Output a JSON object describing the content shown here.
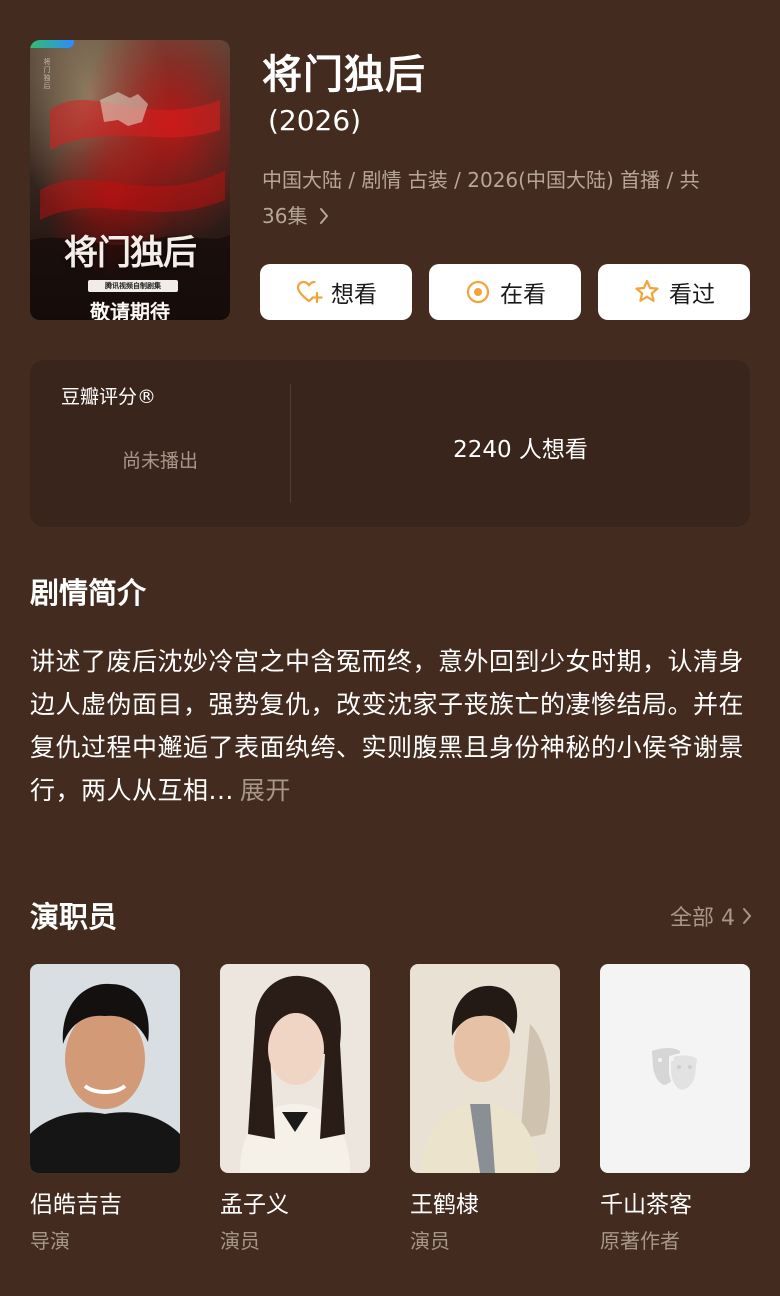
{
  "show": {
    "title": "将门独后",
    "year": "(2026)",
    "meta_line1": "中国大陆 / 剧情 古装 / 2026(中国大陆) 首播 / 共",
    "meta_line2": "36集"
  },
  "poster": {
    "title": "将门独后",
    "badge": "腾讯视频自制剧集",
    "tagline": "敬请期待"
  },
  "actions": [
    {
      "label": "想看",
      "icon": "heart-plus-icon"
    },
    {
      "label": "在看",
      "icon": "target-circle-icon"
    },
    {
      "label": "看过",
      "icon": "star-outline-icon"
    }
  ],
  "rating": {
    "label": "豆瓣评分®",
    "status": "尚未播出",
    "want_count": "2240 人想看"
  },
  "synopsis": {
    "heading": "剧情简介",
    "text": "讲述了废后沈妙冷宫之中含冤而终，意外回到少女时期，认清身边人虚伪面目，强势复仇，改变沈家子丧族亡的凄惨结局。并在复仇过程中邂逅了表面纨绔、实则腹黑且身份神秘的小侯爷谢景行，两人从互相...",
    "expand": "展开"
  },
  "cast": {
    "heading": "演职员",
    "all_label": "全部 4",
    "members": [
      {
        "name": "侣皓吉吉",
        "role": "导演"
      },
      {
        "name": "孟子义",
        "role": "演员"
      },
      {
        "name": "王鹤棣",
        "role": "演员"
      },
      {
        "name": "千山茶客",
        "role": "原著作者"
      }
    ]
  },
  "colors": {
    "background": "#432B20",
    "card": "#39251C",
    "accent": "#F2A33A",
    "muted_text": "#A8968A"
  }
}
